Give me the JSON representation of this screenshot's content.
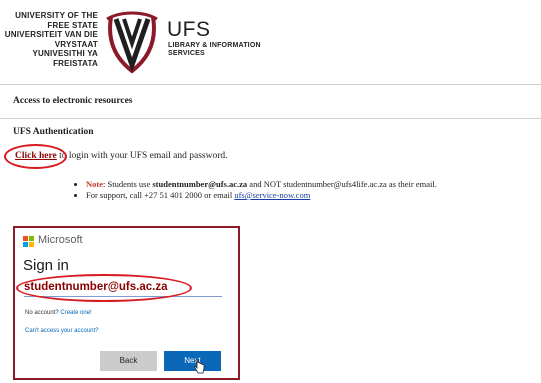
{
  "header": {
    "university_lines": [
      "UNIVERSITY OF THE",
      "FREE STATE",
      "UNIVERSITEIT VAN DIE",
      "VRYSTAAT",
      "YUNIVESITHI YA",
      "FREISTATA"
    ],
    "brand_big": "UFS",
    "brand_small_lines": [
      "LIBRARY & INFORMATION",
      "SERVICES"
    ]
  },
  "content": {
    "access_heading": "Access to electronic resources",
    "auth_heading": "UFS Authentication",
    "click_here": "Click here",
    "login_text": " to login with your UFS email and password.",
    "note_label": "Note",
    "note_text_1": ": Students use ",
    "note_bold": "studentnumber@ufs.ac.za",
    "note_text_2": " and NOT studentnumber@ufs4life.ac.za as their email.",
    "support_text": "For support, call +27 51 401 2000 or email ",
    "support_email": "ufs@service-now.com"
  },
  "microsoft": {
    "brand": "Microsoft",
    "title": "Sign in",
    "email_value": "studentnumber@ufs.ac.za",
    "no_account": "No account?",
    "create_one": "Create one!",
    "cant_access": "Can't access your account?",
    "back_label": "Back",
    "next_label": "Next",
    "logo_colors": [
      "#f25022",
      "#7fba00",
      "#00a4ef",
      "#ffb900"
    ]
  },
  "colors": {
    "highlight": "#d71920",
    "link_red": "#8b0000",
    "ms_blue": "#0b67b8"
  }
}
